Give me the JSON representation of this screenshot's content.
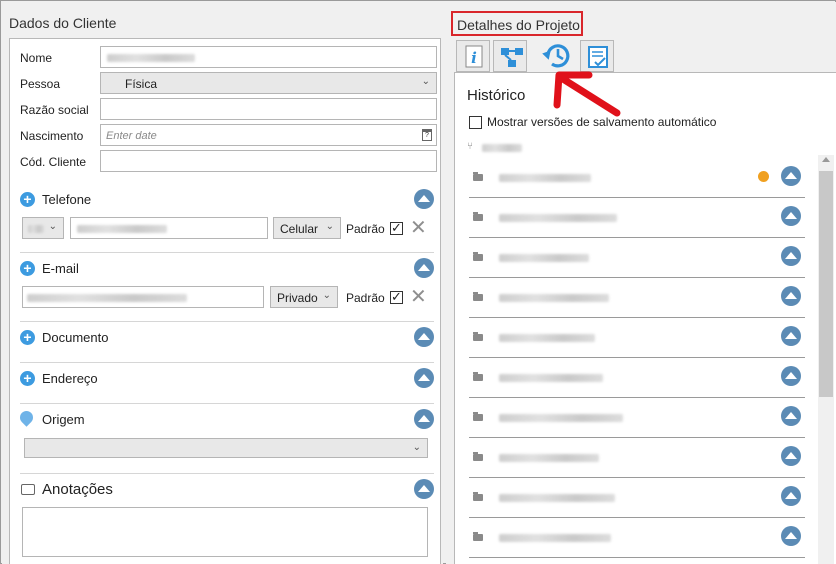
{
  "cliente": {
    "title": "Dados do Cliente",
    "fields": {
      "nome_label": "Nome",
      "pessoa_label": "Pessoa",
      "pessoa_value": "Física",
      "razao_label": "Razão social",
      "nascimento_label": "Nascimento",
      "nascimento_placeholder": "Enter date",
      "cod_label": "Cód. Cliente"
    },
    "sections": {
      "telefone": "Telefone",
      "email": "E-mail",
      "documento": "Documento",
      "endereco": "Endereço",
      "origem": "Origem",
      "anotacoes": "Anotações"
    },
    "telefone": {
      "type": "Celular",
      "padrao_label": "Padrão"
    },
    "email": {
      "type": "Privado",
      "padrao_label": "Padrão"
    }
  },
  "projeto": {
    "title": "Detalhes do Projeto",
    "tabs": [
      "info-tab",
      "structure-tab",
      "history-tab",
      "checklist-tab"
    ],
    "historico_title": "Histórico",
    "auto_save_label": "Mostrar versões de salvamento automático"
  },
  "colors": {
    "accent": "#3d9be0",
    "collapse": "#5b8bb5",
    "highlight_border": "#d9262b",
    "status_dot": "#f0a020"
  }
}
